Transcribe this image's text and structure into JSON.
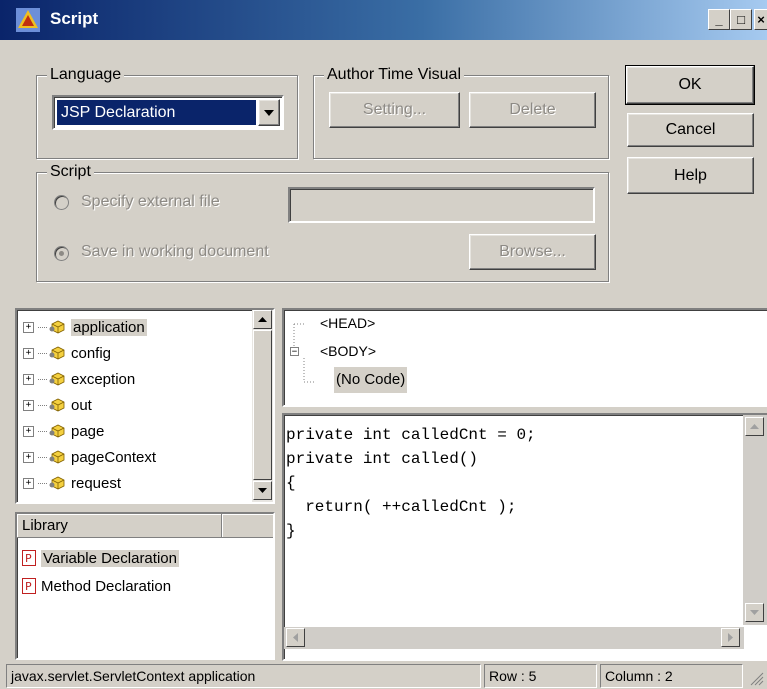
{
  "window": {
    "title": "Script",
    "icon": "script-app-icon",
    "controls": [
      "_",
      "□",
      "×"
    ]
  },
  "language": {
    "label": "Language",
    "selected": "JSP Declaration"
  },
  "author_time": {
    "label": "Author Time Visual",
    "setting_button": "Setting...",
    "delete_button": "Delete"
  },
  "dialog_buttons": {
    "ok": "OK",
    "cancel": "Cancel",
    "help": "Help"
  },
  "script": {
    "label": "Script",
    "external_option": "Specify external file",
    "working_option": "Save in working document",
    "file_path": "",
    "browse_button": "Browse..."
  },
  "objects_tree": [
    {
      "label": "application",
      "icon": "object-icon",
      "selected": true
    },
    {
      "label": "config",
      "icon": "object-icon"
    },
    {
      "label": "exception",
      "icon": "object-icon"
    },
    {
      "label": "out",
      "icon": "object-icon"
    },
    {
      "label": "page",
      "icon": "object-icon"
    },
    {
      "label": "pageContext",
      "icon": "object-icon"
    },
    {
      "label": "request",
      "icon": "object-icon"
    }
  ],
  "library": {
    "header": "Library",
    "items": [
      {
        "label": "Variable Declaration",
        "icon": "declaration-icon",
        "selected": true
      },
      {
        "label": "Method Declaration",
        "icon": "declaration-icon"
      }
    ]
  },
  "document_tree": {
    "head": "<HEAD>",
    "body": "<BODY>",
    "no_code": "(No Code)"
  },
  "code_lines": [
    "private int calledCnt = 0;",
    "private int called()",
    "{",
    "  return( ++calledCnt );",
    "}"
  ],
  "status_bar": {
    "message": "javax.servlet.ServletContext application",
    "row": "Row : 5",
    "column": "Column : 2"
  },
  "colors": {
    "title_start": "#0a246a",
    "title_end": "#a6caf0",
    "face": "#d4d0c8",
    "selection": "#0a246a"
  }
}
